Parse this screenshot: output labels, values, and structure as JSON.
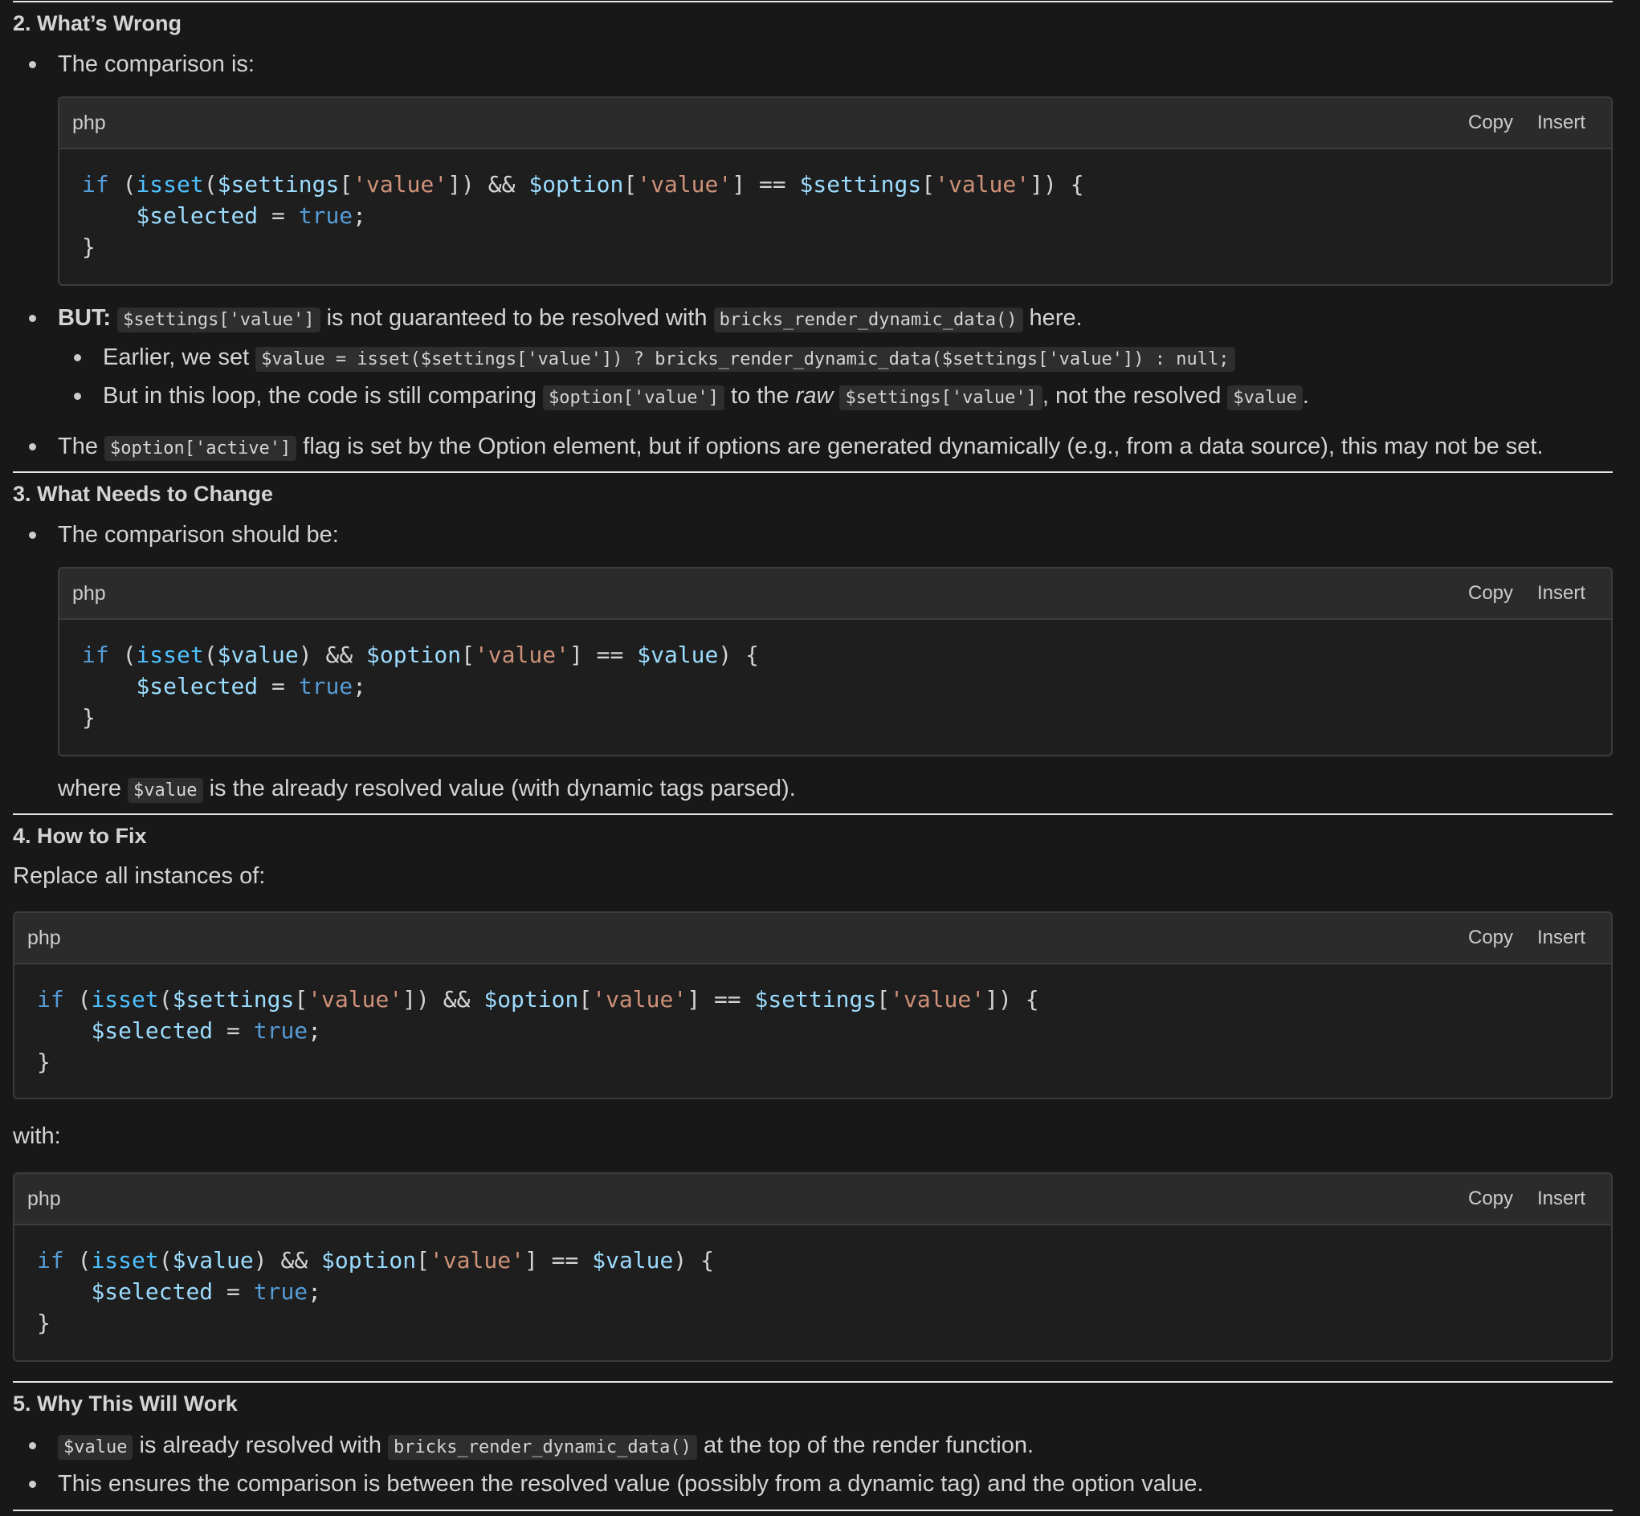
{
  "sections": {
    "s2": {
      "heading": "2. What’s Wrong",
      "b1_text": "The comparison is:",
      "code": {
        "lang": "php",
        "copy": "Copy",
        "insert": "Insert",
        "l1": {
          "if": "if",
          "p1": " (",
          "isset": "isset",
          "p2": "(",
          "v1": "$settings",
          "b1": "[",
          "s1": "'value'",
          "b2": "]) && ",
          "v2": "$option",
          "b3": "[",
          "s2": "'value'",
          "b4": "] == ",
          "v3": "$settings",
          "b5": "[",
          "s3": "'value'",
          "b6": "]) {"
        },
        "l2": {
          "ind": "    ",
          "v": "$selected",
          "eq": " = ",
          "t": "true",
          "semi": ";"
        },
        "l3": "}"
      },
      "but_label": "BUT:",
      "but_code1": "$settings['value']",
      "but_text1": " is not guaranteed to be resolved with ",
      "but_code2": "bricks_render_dynamic_data()",
      "but_text2": " here.",
      "sub1_text": "Earlier, we set ",
      "sub1_code": "$value = isset($settings['value']) ? bricks_render_dynamic_data($settings['value']) : null;",
      "sub2_text1": "But in this loop, the code is still comparing ",
      "sub2_code1": "$option['value']",
      "sub2_text2": " to the ",
      "sub2_em": "raw",
      "sub2_code2": "$settings['value']",
      "sub2_text3": ", not the resolved ",
      "sub2_code3": "$value",
      "sub2_text4": ".",
      "b3_text1": "The ",
      "b3_code": "$option['active']",
      "b3_text2": " flag is set by the Option element, but if options are generated dynamically (e.g., from a data source), this may not be set."
    },
    "s3": {
      "heading": "3. What Needs to Change",
      "b1_text": "The comparison should be:",
      "code": {
        "lang": "php",
        "copy": "Copy",
        "insert": "Insert",
        "l1": {
          "if": "if",
          "p1": " (",
          "isset": "isset",
          "p2": "(",
          "v1": "$value",
          "b1": ") && ",
          "v2": "$option",
          "b2": "[",
          "s1": "'value'",
          "b3": "] == ",
          "v3": "$value",
          "b4": ") {"
        },
        "l2": {
          "ind": "    ",
          "v": "$selected",
          "eq": " = ",
          "t": "true",
          "semi": ";"
        },
        "l3": "}"
      },
      "where_text1": "where ",
      "where_code": "$value",
      "where_text2": " is the already resolved value (with dynamic tags parsed)."
    },
    "s4": {
      "heading": "4. How to Fix",
      "intro": "Replace all instances of:",
      "code_a": {
        "lang": "php",
        "copy": "Copy",
        "insert": "Insert",
        "l1": {
          "if": "if",
          "p1": " (",
          "isset": "isset",
          "p2": "(",
          "v1": "$settings",
          "b1": "[",
          "s1": "'value'",
          "b2": "]) && ",
          "v2": "$option",
          "b3": "[",
          "s2": "'value'",
          "b4": "] == ",
          "v3": "$settings",
          "b5": "[",
          "s3": "'value'",
          "b6": "]) {"
        },
        "l2": {
          "ind": "    ",
          "v": "$selected",
          "eq": " = ",
          "t": "true",
          "semi": ";"
        },
        "l3": "}"
      },
      "with": "with:",
      "code_b": {
        "lang": "php",
        "copy": "Copy",
        "insert": "Insert",
        "l1": {
          "if": "if",
          "p1": " (",
          "isset": "isset",
          "p2": "(",
          "v1": "$value",
          "b1": ") && ",
          "v2": "$option",
          "b2": "[",
          "s1": "'value'",
          "b3": "] == ",
          "v3": "$value",
          "b4": ") {"
        },
        "l2": {
          "ind": "    ",
          "v": "$selected",
          "eq": " = ",
          "t": "true",
          "semi": ";"
        },
        "l3": "}"
      }
    },
    "s5": {
      "heading": "5. Why This Will Work",
      "b1_code1": "$value",
      "b1_text1": " is already resolved with ",
      "b1_code2": "bricks_render_dynamic_data()",
      "b1_text2": " at the top of the render function.",
      "b2_text": "This ensures the comparison is between the resolved value (possibly from a dynamic tag) and the option value."
    }
  }
}
